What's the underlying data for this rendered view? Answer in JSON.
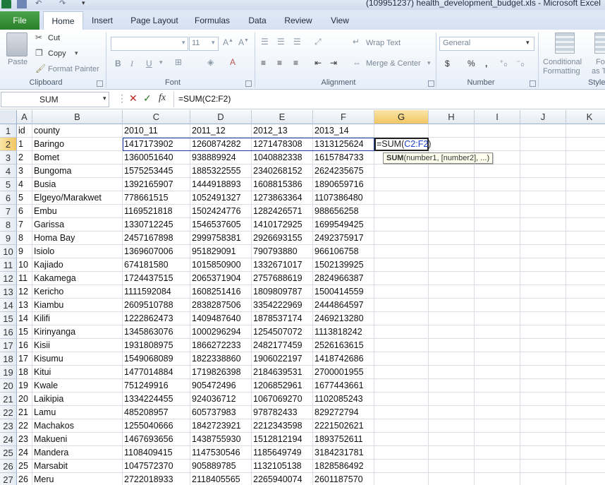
{
  "window": {
    "title": "(109951237) health_development_budget.xls  -  Microsoft Excel"
  },
  "tabs": {
    "file": "File",
    "items": [
      "Home",
      "Insert",
      "Page Layout",
      "Formulas",
      "Data",
      "Review",
      "View"
    ],
    "active": "Home"
  },
  "ribbon": {
    "clipboard": {
      "paste": "Paste",
      "cut": "Cut",
      "copy": "Copy",
      "format_painter": "Format Painter",
      "label": "Clipboard"
    },
    "font": {
      "size": "11",
      "bold": "B",
      "italic": "I",
      "underline": "U",
      "label": "Font"
    },
    "alignment": {
      "wrap_text": "Wrap Text",
      "merge_center": "Merge & Center",
      "label": "Alignment"
    },
    "number": {
      "format": "General",
      "currency": "$",
      "percent": "%",
      "comma": ",",
      "label": "Number"
    },
    "styles": {
      "conditional_formatting_1": "Conditional",
      "conditional_formatting_2": "Formatting",
      "format_as_1": "Fo",
      "format_as_2": "as T",
      "label": "Style"
    }
  },
  "formula_bar": {
    "name_box": "SUM",
    "fx": "fx",
    "formula": "=SUM(C2:F2)"
  },
  "grid": {
    "columns": [
      "A",
      "B",
      "C",
      "D",
      "E",
      "F",
      "G",
      "H",
      "I",
      "J",
      "K"
    ],
    "selected_column": "G",
    "selected_row": 2,
    "rows": [
      [
        "id",
        "county",
        "2010_11",
        "2011_12",
        "2012_13",
        "2013_14"
      ],
      [
        "1",
        "Baringo",
        "1417173902",
        "1260874282",
        "1271478308",
        "1313125624"
      ],
      [
        "2",
        "Bomet",
        "1360051640",
        "938889924",
        "1040882338",
        "1615784733"
      ],
      [
        "3",
        "Bungoma",
        "1575253445",
        "1885322555",
        "2340268152",
        "2624235675"
      ],
      [
        "4",
        "Busia",
        "1392165907",
        "1444918893",
        "1608815386",
        "1890659716"
      ],
      [
        "5",
        "Elgeyo/Marakwet",
        "778661515",
        "1052491327",
        "1273863364",
        "1107386480"
      ],
      [
        "6",
        "Embu",
        "1169521818",
        "1502424776",
        "1282426571",
        "988656258"
      ],
      [
        "7",
        "Garissa",
        "1330712245",
        "1546537605",
        "1410172925",
        "1699549425"
      ],
      [
        "8",
        "Homa Bay",
        "2457167898",
        "2999758381",
        "2926693155",
        "2492375917"
      ],
      [
        "9",
        "Isiolo",
        "1369607006",
        "951829091",
        "790793880",
        "966106758"
      ],
      [
        "10",
        "Kajiado",
        "674181580",
        "1015850900",
        "1332671017",
        "1502139925"
      ],
      [
        "11",
        "Kakamega",
        "1724437515",
        "2065371904",
        "2757688619",
        "2824966387"
      ],
      [
        "12",
        "Kericho",
        "1111592084",
        "1608251416",
        "1809809787",
        "1500414559"
      ],
      [
        "13",
        "Kiambu",
        "2609510788",
        "2838287506",
        "3354222969",
        "2444864597"
      ],
      [
        "14",
        "Kilifi",
        "1222862473",
        "1409487640",
        "1878537174",
        "2469213280"
      ],
      [
        "15",
        "Kirinyanga",
        "1345863076",
        "1000296294",
        "1254507072",
        "1113818242"
      ],
      [
        "16",
        "Kisii",
        "1931808975",
        "1866272233",
        "2482177459",
        "2526163615"
      ],
      [
        "17",
        "Kisumu",
        "1549068089",
        "1822338860",
        "1906022197",
        "1418742686"
      ],
      [
        "18",
        "Kitui",
        "1477014884",
        "1719826398",
        "2184639531",
        "2700001955"
      ],
      [
        "19",
        "Kwale",
        "751249916",
        "905472496",
        "1206852961",
        "1677443661"
      ],
      [
        "20",
        "Laikipia",
        "1334224455",
        "924036712",
        "1067069270",
        "1102085243"
      ],
      [
        "21",
        "Lamu",
        "485208957",
        "605737983",
        "978782433",
        "829272794"
      ],
      [
        "22",
        "Machakos",
        "1255040666",
        "1842723921",
        "2212343598",
        "2221502621"
      ],
      [
        "23",
        "Makueni",
        "1467693656",
        "1438755930",
        "1512812194",
        "1893752611"
      ],
      [
        "24",
        "Mandera",
        "1108409415",
        "1147530546",
        "1185649749",
        "3184231781"
      ],
      [
        "25",
        "Marsabit",
        "1047572370",
        "905889785",
        "1132105138",
        "1828586492"
      ],
      [
        "26",
        "Meru",
        "2722018933",
        "2118405565",
        "2265940074",
        "2601187570"
      ]
    ],
    "active_cell": {
      "prefix": "=SUM(",
      "ref": "C2:F2",
      "suffix": ")"
    },
    "tooltip": {
      "func": "SUM",
      "args": "(number1, [number2], ...)"
    }
  }
}
